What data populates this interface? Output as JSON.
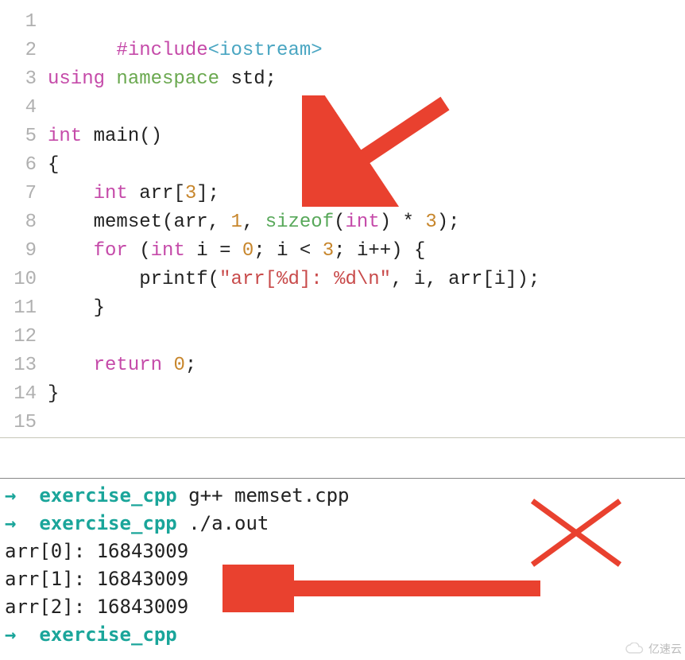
{
  "editor": {
    "line_numbers": [
      "1",
      "2",
      "3",
      "4",
      "5",
      "6",
      "7",
      "8",
      "9",
      "10",
      "11",
      "12",
      "13",
      "14",
      "15"
    ],
    "tok": {
      "include": "#include",
      "iostream": "<iostream>",
      "using": "using",
      "namespace": "namespace",
      "std": "std",
      "semicolon": ";",
      "int": "int",
      "main": "main",
      "paren_open": "(",
      "paren_close": ")",
      "brace_open": "{",
      "brace_close": "}",
      "arr": "arr",
      "brk_open": "[",
      "brk_close": "]",
      "three_a": "3",
      "memset": "memset",
      "comma": ",",
      "one": "1",
      "sizeof": "sizeof",
      "mul": "*",
      "three_b": "3",
      "for": "for",
      "i": "i",
      "eq": "=",
      "zero": "0",
      "lt": "<",
      "three_c": "3",
      "inc": "++",
      "printf": "printf",
      "fmt": "\"arr[%d]: %d\\n\"",
      "arri": "arr[i]",
      "return": "return",
      "zero_b": "0"
    }
  },
  "terminal": {
    "arrow": "→",
    "dir": "exercise_cpp",
    "cmd1": "g++ memset.cpp",
    "cmd2": "./a.out",
    "out0": "arr[0]: 16843009",
    "out1": "arr[1]: 16843009",
    "out2": "arr[2]: 16843009"
  },
  "annotations": {
    "arrow_color": "#e9412f",
    "cross_color": "#e9412f"
  },
  "watermark": {
    "text": "亿速云"
  }
}
